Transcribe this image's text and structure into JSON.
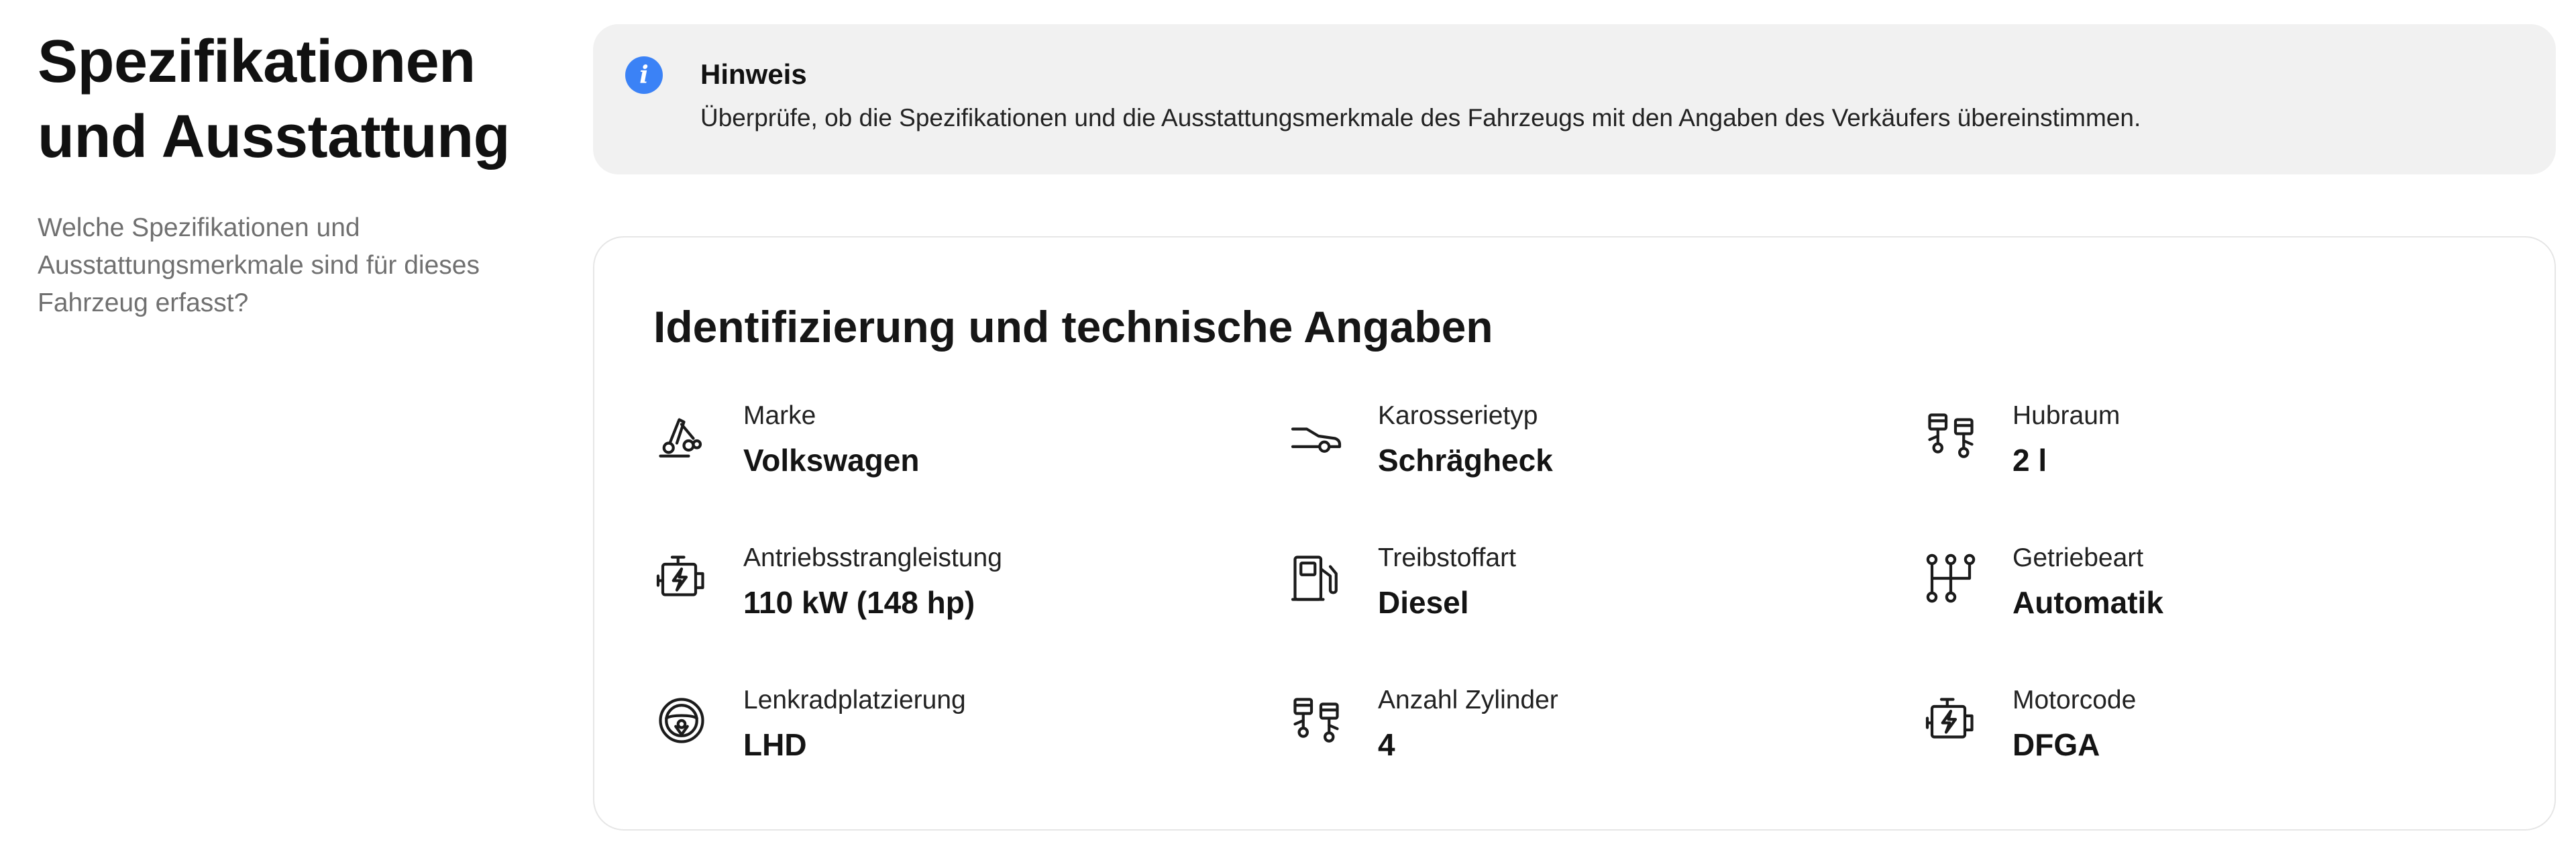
{
  "section": {
    "title": "Spezifikationen und Ausstattung",
    "subtitle": "Welche Spezifikationen und Ausstattungsmerkmale sind für dieses Fahrzeug erfasst?"
  },
  "notice": {
    "icon": "info-icon",
    "title": "Hinweis",
    "body": "Überprüfe, ob die Spezifikationen und die Ausstattungsmerkmale des Fahrzeugs mit den Angaben des Verkäufers übereinstimmen.",
    "accent_color": "#3b82f6"
  },
  "card": {
    "title": "Identifizierung und technische Angaben",
    "specs": [
      {
        "icon": "brand-icon",
        "label": "Marke",
        "value": "Volkswagen"
      },
      {
        "icon": "car-body-icon",
        "label": "Karosserietyp",
        "value": "Schrägheck"
      },
      {
        "icon": "cylinders-icon",
        "label": "Hubraum",
        "value": "2 l"
      },
      {
        "icon": "engine-icon",
        "label": "Antriebsstrangleistung",
        "value": "110 kW (148 hp)"
      },
      {
        "icon": "fuel-pump-icon",
        "label": "Treibstoffart",
        "value": "Diesel"
      },
      {
        "icon": "gearbox-icon",
        "label": "Getriebeart",
        "value": "Automatik"
      },
      {
        "icon": "steering-wheel-icon",
        "label": "Lenkradplatzierung",
        "value": "LHD"
      },
      {
        "icon": "cylinders-icon",
        "label": "Anzahl Zylinder",
        "value": "4"
      },
      {
        "icon": "engine-icon",
        "label": "Motorcode",
        "value": "DFGA"
      }
    ]
  }
}
